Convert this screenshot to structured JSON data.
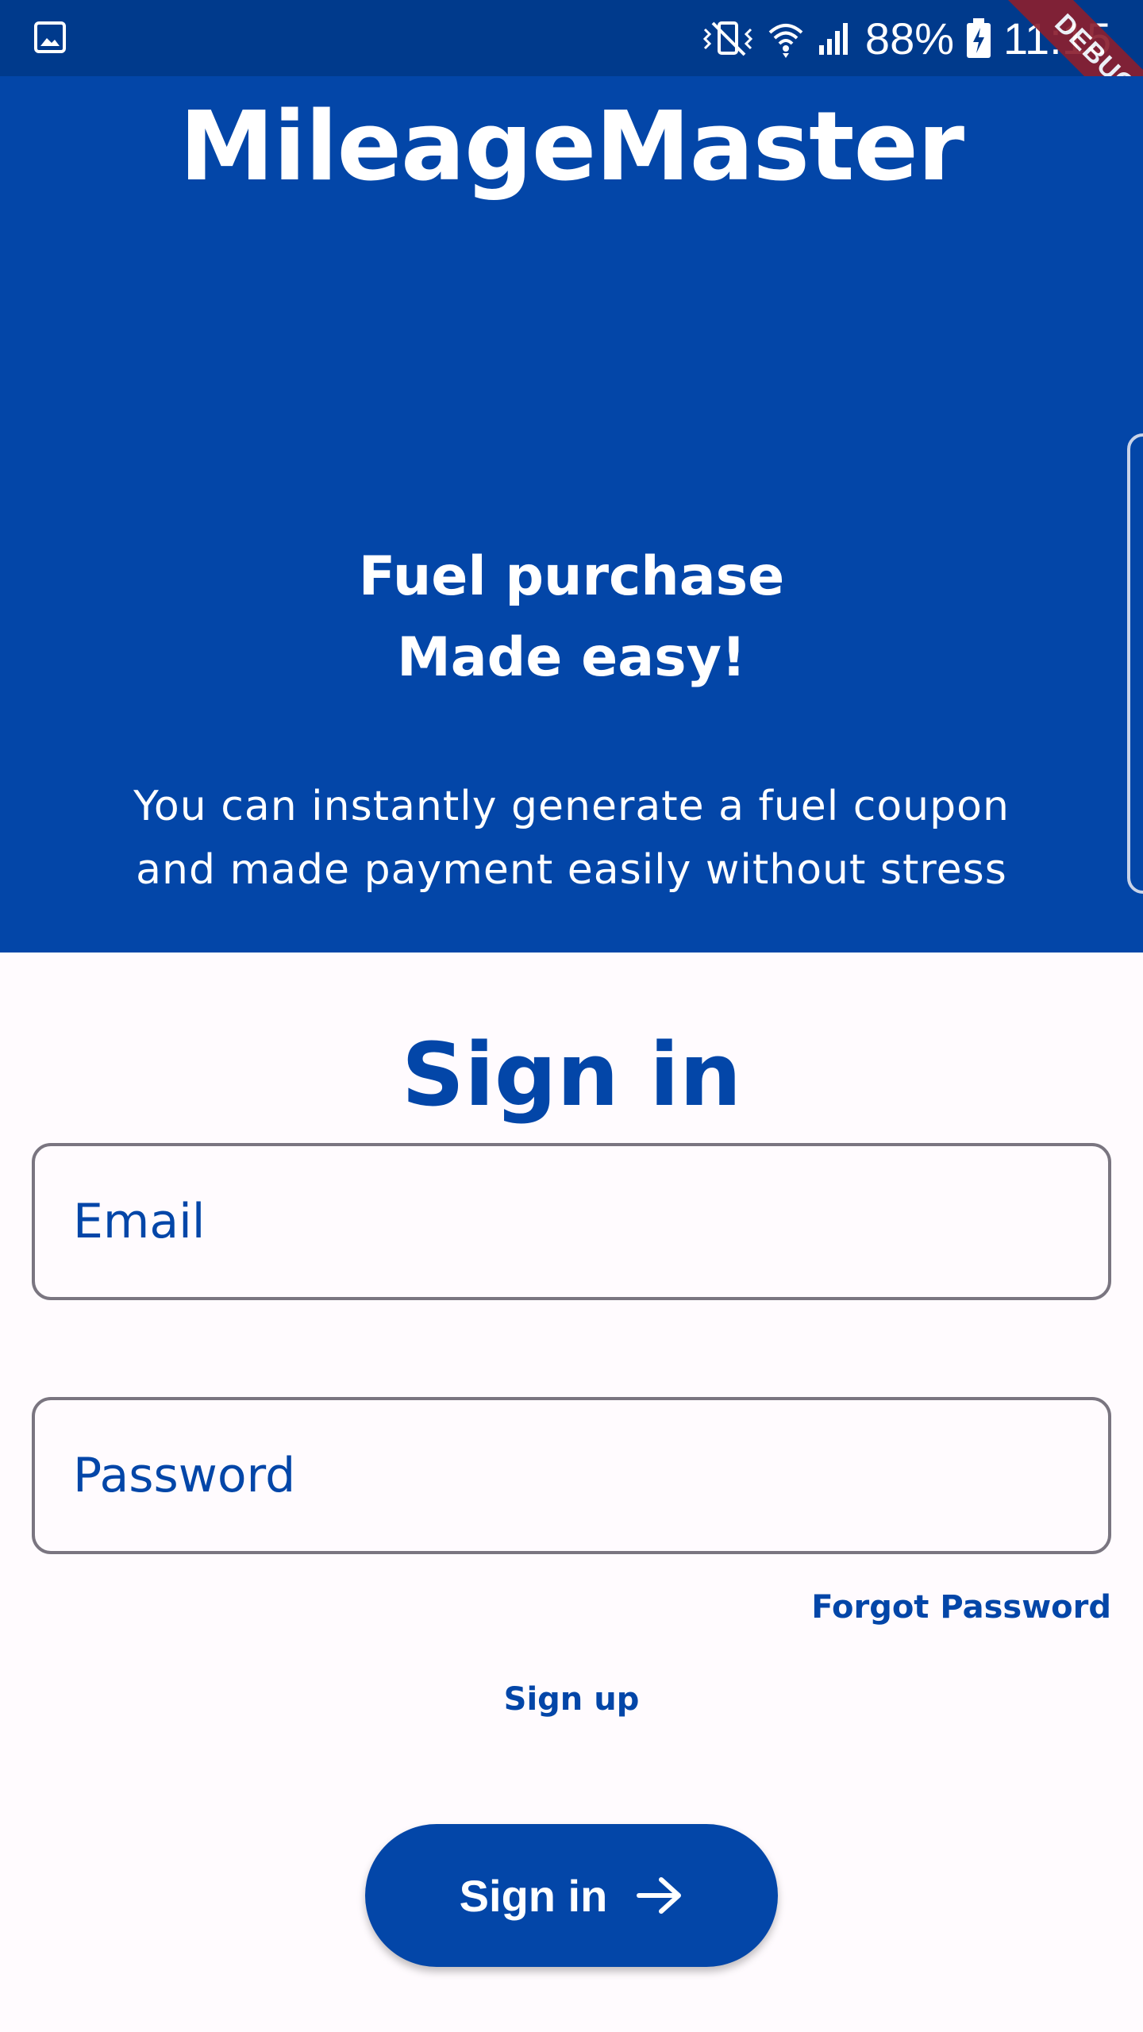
{
  "status_bar": {
    "battery_percent": "88%",
    "time": "11:15",
    "icons": [
      "gallery-icon",
      "mute-vibrate-icon",
      "wifi-icon",
      "signal-icon",
      "battery-charging-icon"
    ]
  },
  "debug_banner": "DEBUG",
  "hero": {
    "app_title": "MileageMaster",
    "tagline_line1": "Fuel purchase",
    "tagline_line2": "Made easy!",
    "description_line1": "You can instantly generate a fuel coupon",
    "description_line2": "and made payment easily without stress"
  },
  "signin": {
    "title": "Sign in",
    "email_placeholder": "Email",
    "password_placeholder": "Password",
    "forgot_password": "Forgot Password",
    "sign_up": "Sign up",
    "button_label": "Sign in",
    "button_icon": "arrow-right-icon"
  },
  "colors": {
    "primary": "#0346a8",
    "status_bar": "#003a8c",
    "background": "#fffbfe",
    "field_border": "#7a7580",
    "debug_banner": "#8a1f2f"
  }
}
